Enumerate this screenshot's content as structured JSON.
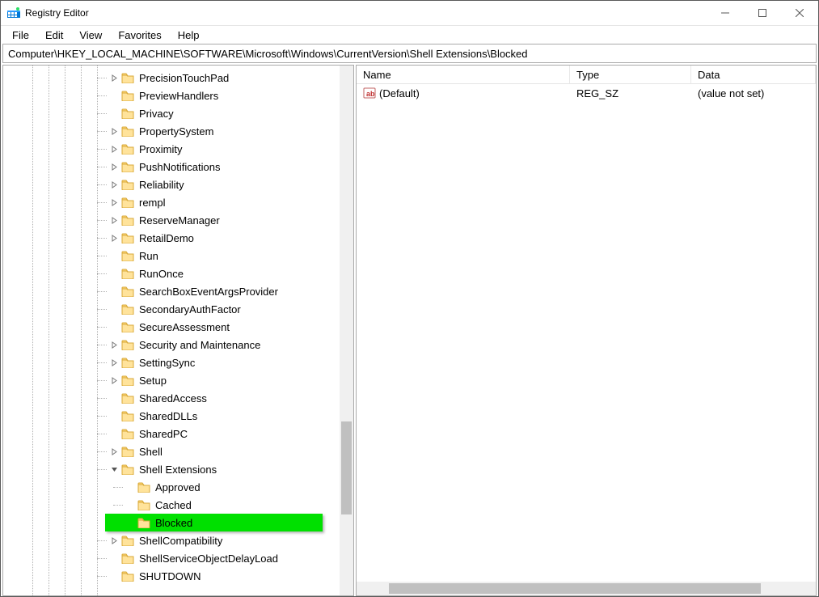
{
  "title": "Registry Editor",
  "menu": [
    "File",
    "Edit",
    "View",
    "Favorites",
    "Help"
  ],
  "address": "Computer\\HKEY_LOCAL_MACHINE\\SOFTWARE\\Microsoft\\Windows\\CurrentVersion\\Shell Extensions\\Blocked",
  "tree": [
    {
      "label": "PrecisionTouchPad",
      "level": 6,
      "expandable": true
    },
    {
      "label": "PreviewHandlers",
      "level": 6,
      "expandable": false
    },
    {
      "label": "Privacy",
      "level": 6,
      "expandable": false
    },
    {
      "label": "PropertySystem",
      "level": 6,
      "expandable": true
    },
    {
      "label": "Proximity",
      "level": 6,
      "expandable": true
    },
    {
      "label": "PushNotifications",
      "level": 6,
      "expandable": true
    },
    {
      "label": "Reliability",
      "level": 6,
      "expandable": true
    },
    {
      "label": "rempl",
      "level": 6,
      "expandable": true
    },
    {
      "label": "ReserveManager",
      "level": 6,
      "expandable": true
    },
    {
      "label": "RetailDemo",
      "level": 6,
      "expandable": true
    },
    {
      "label": "Run",
      "level": 6,
      "expandable": false
    },
    {
      "label": "RunOnce",
      "level": 6,
      "expandable": false
    },
    {
      "label": "SearchBoxEventArgsProvider",
      "level": 6,
      "expandable": false
    },
    {
      "label": "SecondaryAuthFactor",
      "level": 6,
      "expandable": false
    },
    {
      "label": "SecureAssessment",
      "level": 6,
      "expandable": false
    },
    {
      "label": "Security and Maintenance",
      "level": 6,
      "expandable": true
    },
    {
      "label": "SettingSync",
      "level": 6,
      "expandable": true
    },
    {
      "label": "Setup",
      "level": 6,
      "expandable": true
    },
    {
      "label": "SharedAccess",
      "level": 6,
      "expandable": false
    },
    {
      "label": "SharedDLLs",
      "level": 6,
      "expandable": false
    },
    {
      "label": "SharedPC",
      "level": 6,
      "expandable": false
    },
    {
      "label": "Shell",
      "level": 6,
      "expandable": true
    },
    {
      "label": "Shell Extensions",
      "level": 6,
      "expandable": true,
      "open": true
    },
    {
      "label": "Approved",
      "level": 7,
      "expandable": false
    },
    {
      "label": "Cached",
      "level": 7,
      "expandable": false
    },
    {
      "label": "Blocked",
      "level": 7,
      "expandable": false,
      "highlight": true
    },
    {
      "label": "ShellCompatibility",
      "level": 6,
      "expandable": true
    },
    {
      "label": "ShellServiceObjectDelayLoad",
      "level": 6,
      "expandable": false
    },
    {
      "label": "SHUTDOWN",
      "level": 6,
      "expandable": false
    }
  ],
  "list": {
    "columns": {
      "name": "Name",
      "type": "Type",
      "data": "Data"
    },
    "rows": [
      {
        "name": "(Default)",
        "type": "REG_SZ",
        "data": "(value not set)"
      }
    ]
  }
}
